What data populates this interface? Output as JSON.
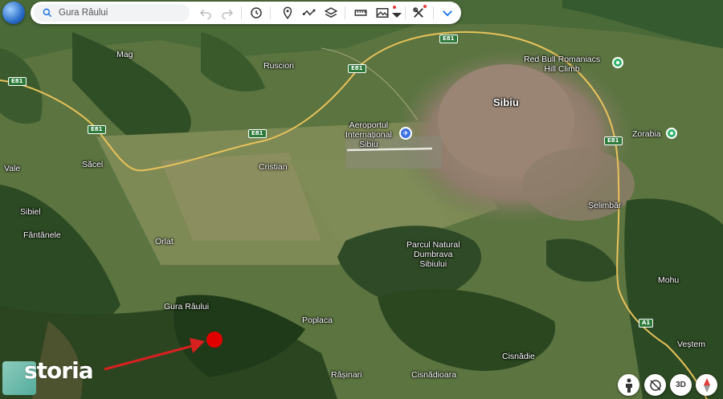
{
  "search": {
    "value": "Gura Râului"
  },
  "roads": {
    "e81": "E81",
    "a1": "A1"
  },
  "places": {
    "mag": "Mag",
    "rusciori": "Rusciori",
    "sibiu": "Sibiu",
    "red_bull": "Red Bull Romaniacs\nHill Climb",
    "aeroport": "Aeroportul\nInternațional\nSibiu",
    "zorabia": "Zorabia",
    "vale": "Vale",
    "sacel": "Săcel",
    "cristian": "Cristian",
    "sibiel": "Sibiel",
    "fantanele": "Fântânele",
    "selimbar": "Șelimbăr",
    "orlat": "Orlat",
    "dumbrava": "Parcul Natural\nDumbrava\nSibiului",
    "mohu": "Mohu",
    "gura_raului": "Gura Râului",
    "poplaca": "Poplaca",
    "vestem": "Veștem",
    "cisnadie": "Cisnădie",
    "rasinari": "Rășinari",
    "cisnadioara": "Cisnădioara"
  },
  "watermark": {
    "brand": "storia"
  },
  "controls": {
    "view3d": "3D"
  },
  "colors": {
    "pin_green": "#2fb36b",
    "airport_blue": "#3b6fe0",
    "marker_red": "#e00000",
    "road": "#e8c25a"
  }
}
